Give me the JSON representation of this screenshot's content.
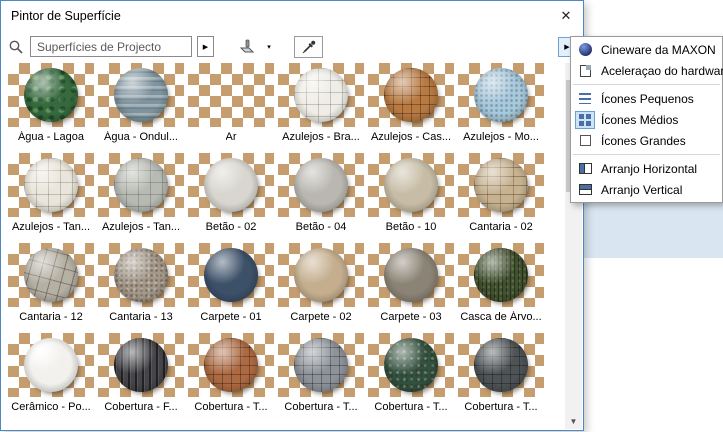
{
  "window": {
    "title": "Pintor de Superfície",
    "close": "✕"
  },
  "toolbar": {
    "scope_value": "Superfícies de Projecto",
    "combo_arrow": "▶",
    "paint_drop_arrow": "▾",
    "flyout_arrow": "▶"
  },
  "scrollbar": {
    "up": "▲",
    "down": "▼"
  },
  "materials": [
    {
      "label": "Água - Lagoa",
      "color": "#36693d",
      "pattern": "mottle"
    },
    {
      "label": "Água - Ondul...",
      "color": "#7d939e",
      "pattern": "waves"
    },
    {
      "label": "Ar",
      "color": null,
      "pattern": "none"
    },
    {
      "label": "Azulejos - Bra...",
      "color": "#efede6",
      "pattern": "tiles"
    },
    {
      "label": "Azulejos - Cas...",
      "color": "#b97a42",
      "pattern": "grid"
    },
    {
      "label": "Azulejos - Mo...",
      "color": "#a8c9da",
      "pattern": "speckle"
    },
    {
      "label": "Azulejos - Tan...",
      "color": "#e9e5da",
      "pattern": "tiles"
    },
    {
      "label": "Azulejos - Tan...",
      "color": "#b7bab3",
      "pattern": "tiles"
    },
    {
      "label": "Betão - 02",
      "color": "#d8d6cf",
      "pattern": "none"
    },
    {
      "label": "Betão - 04",
      "color": "#b9b7b0",
      "pattern": "none"
    },
    {
      "label": "Betão - 10",
      "color": "#c7bda6",
      "pattern": "none"
    },
    {
      "label": "Cantaria - 02",
      "color": "#c6b291",
      "pattern": "blocks"
    },
    {
      "label": "Cantaria - 12",
      "color": "#b5b0a4",
      "pattern": "cracks"
    },
    {
      "label": "Cantaria - 13",
      "color": "#a3988a",
      "pattern": "noise"
    },
    {
      "label": "Carpete - 01",
      "color": "#3c5068",
      "pattern": "none"
    },
    {
      "label": "Carpete - 02",
      "color": "#c4ae8e",
      "pattern": "none"
    },
    {
      "label": "Carpete - 03",
      "color": "#8b8375",
      "pattern": "none"
    },
    {
      "label": "Casca de Árvo...",
      "color": "#41502f",
      "pattern": "bark"
    },
    {
      "label": "Cerâmico - Po...",
      "color": "#f2f1ed",
      "pattern": "gloss"
    },
    {
      "label": "Cobertura - F...",
      "color": "#45454a",
      "pattern": "ribs"
    },
    {
      "label": "Cobertura - T...",
      "color": "#ad6a42",
      "pattern": "grid"
    },
    {
      "label": "Cobertura - T...",
      "color": "#8e9399",
      "pattern": "grid"
    },
    {
      "label": "Cobertura - T...",
      "color": "#31523f",
      "pattern": "noise"
    },
    {
      "label": "Cobertura - T...",
      "color": "#4e5356",
      "pattern": "grid"
    }
  ],
  "menu": {
    "items": [
      {
        "label": "Cineware da MAXON",
        "icon": "cineware-ball-icon"
      },
      {
        "label": "Aceleraçao do hardware",
        "icon": "hardware-acceleration-icon"
      },
      {
        "label": "Ícones Pequenos",
        "icon": "icons-small-icon"
      },
      {
        "label": "Ícones Médios",
        "icon": "icons-medium-icon",
        "selected": true
      },
      {
        "label": "Ícones Grandes",
        "icon": "icons-large-icon"
      },
      {
        "label": "Arranjo Horizontal",
        "icon": "arrange-horizontal-icon"
      },
      {
        "label": "Arranjo Vertical",
        "icon": "arrange-vertical-icon"
      }
    ]
  },
  "colors": {
    "dialog_border": "#4f86c6",
    "checker": "#c59d6e",
    "panel_blue": "#d9e6f1",
    "menu_selected_bg": "#cde4f7",
    "icon_blue": "#4a6fa5"
  }
}
